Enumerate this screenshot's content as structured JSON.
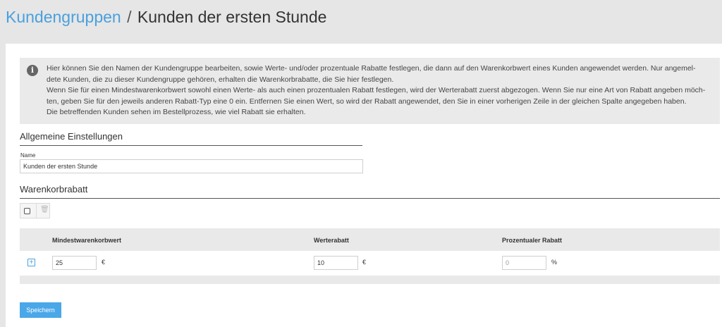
{
  "header": {
    "breadcrumb_link": "Kundengruppen",
    "separator": "/",
    "current": "Kunden der ersten Stunde"
  },
  "info": {
    "icon": "info-icon",
    "lines": [
      "Hier können Sie den Namen der Kundengruppe bearbeiten, sowie Werte- und/oder prozentuale Rabatte festlegen, die dann auf den Warenkorbwert eines Kunden angewendet werden. Nur angemel-",
      "dete Kunden, die zu dieser Kundengruppe gehören, erhalten die Warenkorbrabatte, die Sie hier festlegen.",
      "Wenn Sie für einen Mindestwarenkorbwert sowohl einen Werte- als auch einen prozentualen Rabatt festlegen, wird der Werterabatt zuerst abgezogen. Wenn Sie nur eine Art von Rabatt angeben möch-",
      "ten, geben Sie für den jeweils anderen Rabatt-Typ eine 0 ein. Entfernen Sie einen Wert, so wird der Rabatt angewendet, den Sie in einer vorherigen Zeile in der gleichen Spalte angegeben haben.",
      "Die betreffenden Kunden sehen im Bestellprozess, wie viel Rabatt sie erhalten."
    ]
  },
  "general": {
    "title": "Allgemeine Einstellungen",
    "name_label": "Name",
    "name_value": "Kunden der ersten Stunde"
  },
  "cart_discount": {
    "title": "Warenkorbrabatt",
    "columns": [
      "Mindestwarenkorbwert",
      "Werterabatt",
      "Prozentualer Rabatt"
    ],
    "row": {
      "min_value": "25",
      "min_unit": "€",
      "value_discount": "10",
      "value_unit": "€",
      "percent_discount": "0",
      "percent_unit": "%"
    }
  },
  "actions": {
    "save_label": "Speichern"
  },
  "colors": {
    "accent": "#4aa0de",
    "button": "#4aa7e8",
    "background": "#e6e6e6"
  }
}
